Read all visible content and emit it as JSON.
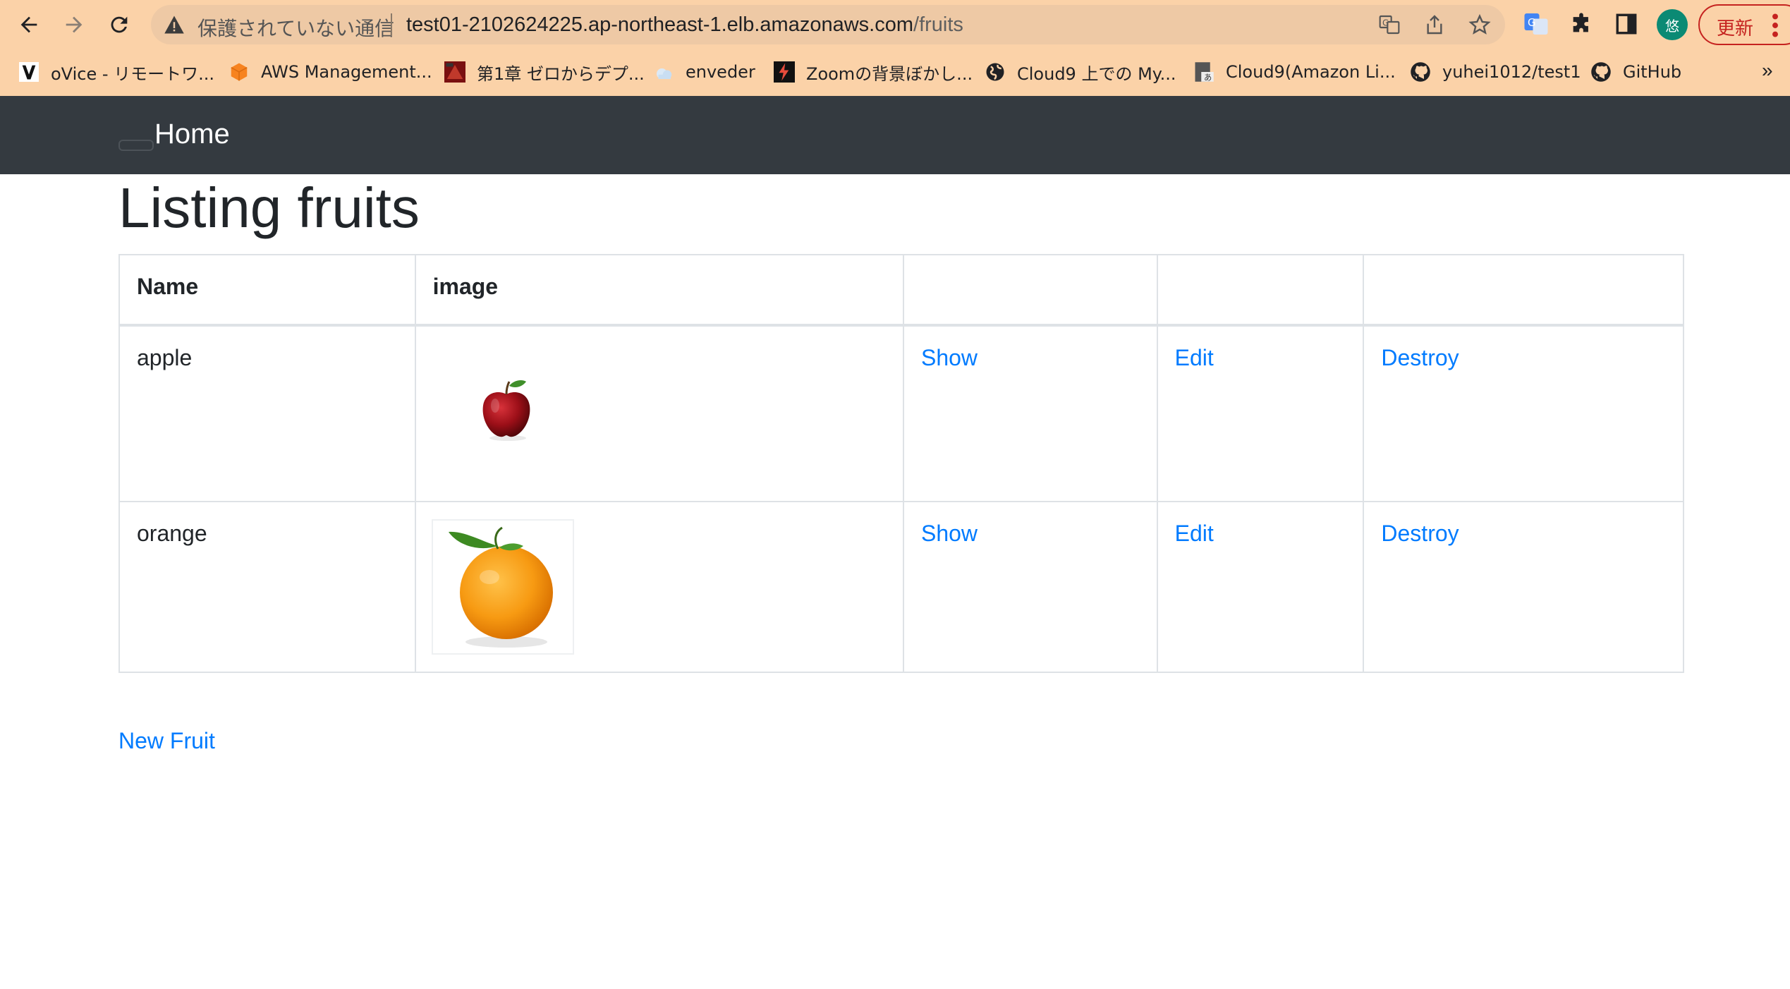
{
  "browser": {
    "security_label": "保護されていない通信",
    "url_host": "test01-2102624225.ap-northeast-1.elb.amazonaws.com",
    "url_path": "/fruits",
    "avatar_initial": "悠",
    "update_label": "更新",
    "bookmarks": [
      {
        "label": "oVice - リモートワ...",
        "icon": "ovice-icon"
      },
      {
        "label": "AWS Management...",
        "icon": "aws-cube-icon"
      },
      {
        "label": "第1章 ゼロからデプ...",
        "icon": "book-cover-icon"
      },
      {
        "label": "enveder",
        "icon": "cloud-icon"
      },
      {
        "label": "Zoomの背景ぼかし...",
        "icon": "bolt-icon"
      },
      {
        "label": "Cloud9 上での My...",
        "icon": "globe-icon"
      },
      {
        "label": "Cloud9(Amazon Li...",
        "icon": "page-icon"
      },
      {
        "label": "yuhei1012/test1",
        "icon": "github-icon"
      },
      {
        "label": "GitHub",
        "icon": "github-icon"
      }
    ],
    "bookmarks_more": "»"
  },
  "nav": {
    "home_label": "Home"
  },
  "page": {
    "title": "Listing fruits",
    "table": {
      "headers": [
        "Name",
        "image",
        "",
        "",
        ""
      ],
      "rows": [
        {
          "name": "apple",
          "image": "apple-image",
          "show": "Show",
          "edit": "Edit",
          "destroy": "Destroy"
        },
        {
          "name": "orange",
          "image": "orange-image",
          "show": "Show",
          "edit": "Edit",
          "destroy": "Destroy"
        }
      ]
    },
    "new_link": "New Fruit"
  },
  "colors": {
    "chrome_bg": "#fbd2a8",
    "navbar_bg": "#343a40",
    "link": "#007bff",
    "text": "#212529",
    "update": "#c5221f"
  }
}
